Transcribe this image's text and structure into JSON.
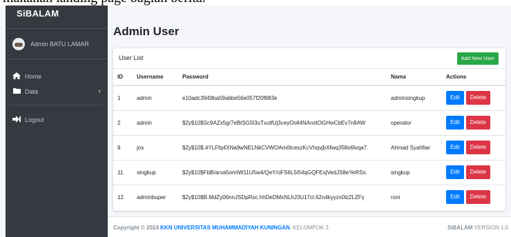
{
  "top_text": "makanan landing page bagian berita.",
  "sidebar": {
    "brand": "SiBALAM",
    "user_name": "Admin BATU LAMAR",
    "items": [
      {
        "label": "Home",
        "icon": "home-icon"
      },
      {
        "label": "Data",
        "icon": "folder-icon",
        "chevron": "‹"
      },
      {
        "label": "Logout",
        "icon": "logout-icon"
      }
    ]
  },
  "page": {
    "title": "Admin User"
  },
  "card": {
    "title": "User List",
    "add_button": "Add New User"
  },
  "table": {
    "headers": [
      "ID",
      "Username",
      "Password",
      "Nama",
      "Actions"
    ],
    "rows": [
      {
        "id": "1",
        "username": "admin",
        "password": "e10adc3949ba59abbe56e057f20f883e",
        "nama": "adminsingkup"
      },
      {
        "id": "2",
        "username": "admin",
        "password": "$2y$10$Sc9AZx5g/7eBtSG5l3uTxutfUj3ceyOoll4NAnstOGHwCbEv7n8AW",
        "nama": "operator"
      },
      {
        "id": "9",
        "username": "jos",
        "password": "$2y$10$.4YLFfq4XNa9wNELNkCVWOAm0tceszKcVhqvjbXfwq358o6lvqa7.",
        "nama": "Ahmad Syahfiar"
      },
      {
        "id": "11",
        "username": "singkup",
        "password": "$2y$10$FbB/arxa5omIW11U5w4/QeY/oFS6L5i54qGQFExjVedJS8eYeRSx.",
        "nama": "singkup"
      },
      {
        "id": "12",
        "username": "adminbuper",
        "password": "$2y$10$B.MdZy06nnJSDpRsc.hhDeDMxNLhJ3U17cl.62n4kyyzx0lz2LZFy",
        "nama": "roni"
      }
    ],
    "edit_label": "Edit",
    "delete_label": "Delete"
  },
  "footer": {
    "copyright": "Copyright © 2024",
    "link": "KKN UNIVERSITAS MUHAMMADIYAH KUNINGAN",
    "suffix": ". KELOMPOK 2.",
    "version_brand": "SiBALAM",
    "version_text": "VERSION 1.0"
  },
  "colors": {
    "sidebar_bg": "#343a40",
    "add_button": "#28a745",
    "edit_button": "#007bff",
    "delete_button": "#dc3545"
  }
}
